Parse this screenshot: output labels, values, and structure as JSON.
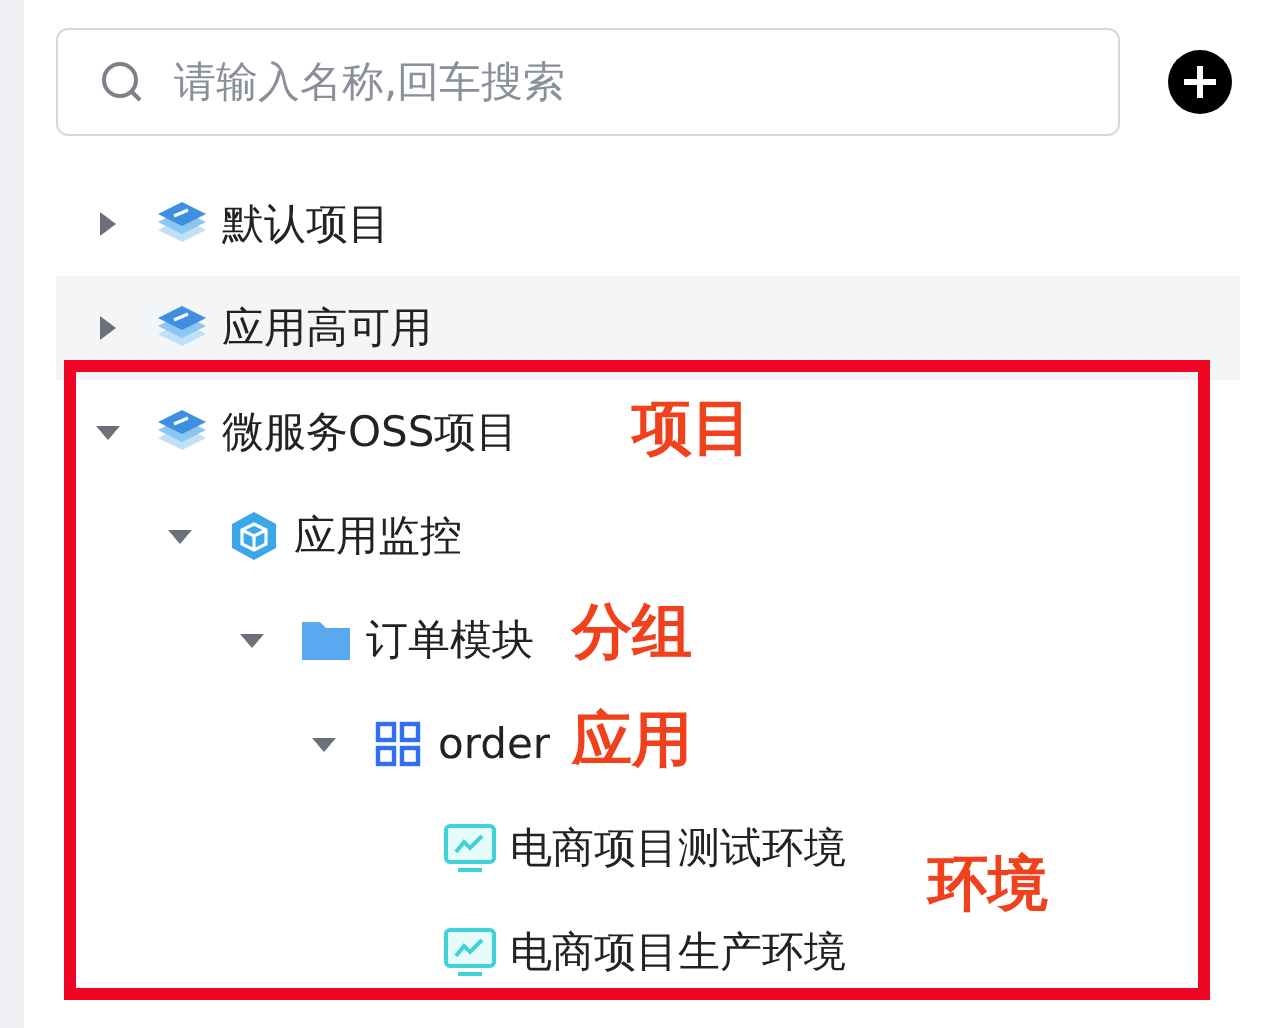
{
  "search": {
    "placeholder": "请输入名称,回车搜索"
  },
  "tree": [
    {
      "kind": "project",
      "label": "默认项目",
      "expanded": false,
      "highlighted": false
    },
    {
      "kind": "project",
      "label": "应用高可用",
      "expanded": false,
      "highlighted": true
    },
    {
      "kind": "project",
      "label": "微服务OSS项目",
      "expanded": true,
      "highlighted": false,
      "children": [
        {
          "kind": "module",
          "label": "应用监控",
          "expanded": true,
          "highlighted": false,
          "children": [
            {
              "kind": "group",
              "label": "订单模块",
              "expanded": true,
              "highlighted": false,
              "children": [
                {
                  "kind": "app",
                  "label": "order",
                  "expanded": true,
                  "highlighted": false,
                  "children": [
                    {
                      "kind": "environment",
                      "label": "电商项目测试环境",
                      "highlighted": false
                    },
                    {
                      "kind": "environment",
                      "label": "电商项目生产环境",
                      "highlighted": false
                    }
                  ]
                }
              ]
            }
          ]
        }
      ]
    }
  ],
  "annotations": [
    {
      "text": "项目"
    },
    {
      "text": "分组"
    },
    {
      "text": "应用"
    },
    {
      "text": "环境"
    }
  ]
}
